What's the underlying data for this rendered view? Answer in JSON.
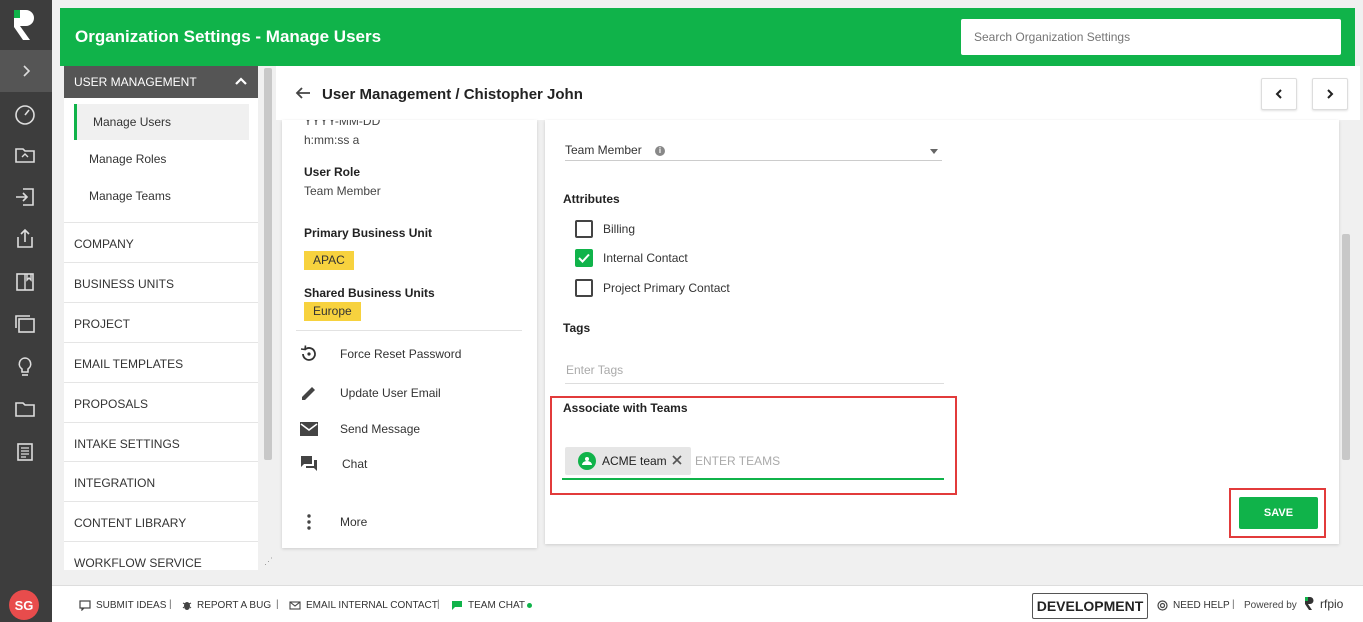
{
  "colors": {
    "brand": "#10b34a",
    "rail": "#3d3d3d",
    "highlight": "#e23b3b",
    "chip": "#f7d23e",
    "avatar": "#e84c4c"
  },
  "header": {
    "title": "Organization Settings - Manage Users",
    "search_placeholder": "Search Organization Settings"
  },
  "rail": {
    "icons": [
      "rfpio-logo-icon",
      "chevron-right-icon",
      "dashboard-gauge-icon",
      "projects-folder-icon",
      "intake-icon",
      "export-icon",
      "library-book-icon",
      "windows-icon",
      "lightbulb-icon",
      "folder-icon",
      "documents-icon"
    ],
    "avatar_initials": "SG"
  },
  "menu": {
    "section": "USER MANAGEMENT",
    "sub_items": [
      {
        "label": "Manage Users",
        "active": true
      },
      {
        "label": "Manage Roles",
        "active": false
      },
      {
        "label": "Manage Teams",
        "active": false
      }
    ],
    "items": [
      "COMPANY",
      "BUSINESS UNITS",
      "PROJECT",
      "EMAIL TEMPLATES",
      "PROPOSALS",
      "INTAKE SETTINGS",
      "INTEGRATION",
      "CONTENT LIBRARY",
      "WORKFLOW SERVICE"
    ]
  },
  "breadcrumb": {
    "text": "User Management / Chistopher John"
  },
  "info": {
    "date_format_partial": "YYYY-MM-DD",
    "time_format": "h:mm:ss a",
    "user_role_label": "User Role",
    "user_role_value": "Team Member",
    "primary_bu_label": "Primary Business Unit",
    "primary_bu_value": "APAC",
    "shared_bu_label": "Shared Business Units",
    "shared_bu_value": "Europe",
    "actions": [
      "Force Reset Password",
      "Update User Email",
      "Send Message",
      "Chat",
      "More"
    ]
  },
  "form": {
    "role_select_value": "Team Member",
    "attributes_label": "Attributes",
    "attributes": [
      {
        "label": "Billing",
        "checked": false
      },
      {
        "label": "Internal Contact",
        "checked": true
      },
      {
        "label": "Project Primary Contact",
        "checked": false
      }
    ],
    "tags_label": "Tags",
    "tags_placeholder": "Enter Tags",
    "teams_label": "Associate with Teams",
    "team_chip": "ACME team",
    "teams_placeholder": "ENTER TEAMS",
    "save_label": "SAVE"
  },
  "footer": {
    "submit_ideas": "SUBMIT IDEAS",
    "report_bug": "REPORT A BUG",
    "email_contact": "EMAIL INTERNAL CONTACT",
    "team_chat": "TEAM CHAT",
    "separator": "|",
    "environment": "DEVELOPMENT",
    "need_help": "NEED HELP",
    "powered_by": "Powered by",
    "brand": "rfpio"
  }
}
